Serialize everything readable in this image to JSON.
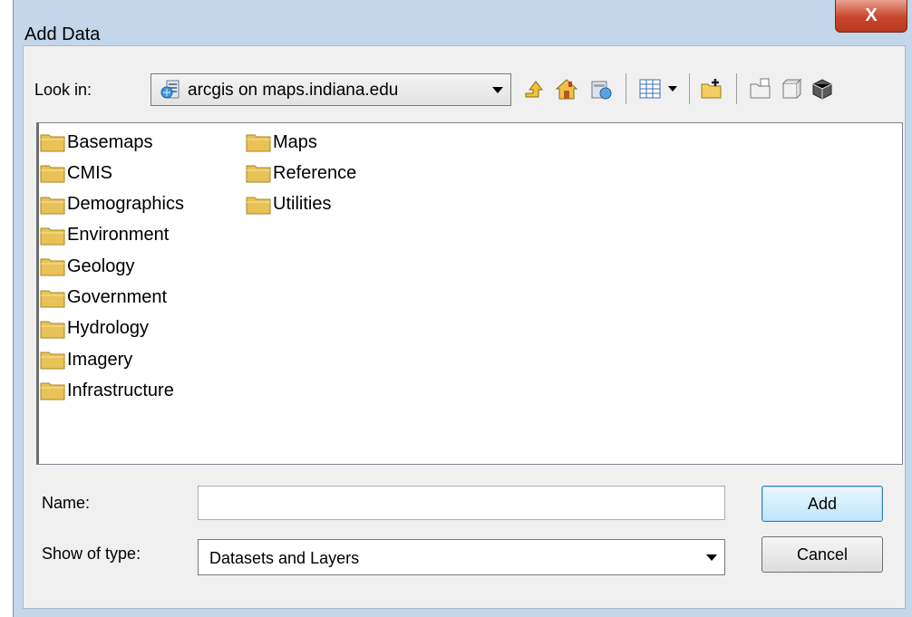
{
  "window": {
    "title": "Add Data",
    "close_glyph": "X"
  },
  "lookin": {
    "label": "Look in:",
    "value": "arcgis on maps.indiana.edu",
    "icon": "server-icon"
  },
  "toolbar": {
    "icons": [
      "up-one-level-icon",
      "home-icon",
      "connect-folder-icon",
      "view-list-icon",
      "view-dropdown-icon",
      "new-folder-icon",
      "new-file-geodatabase-icon",
      "new-shapefile-icon",
      "catalog-options-icon"
    ]
  },
  "folders": {
    "col1": [
      "Basemaps",
      "CMIS",
      "Demographics",
      "Environment",
      "Geology",
      "Government",
      "Hydrology",
      "Imagery",
      "Infrastructure"
    ],
    "col2": [
      "Maps",
      "Reference",
      "Utilities"
    ]
  },
  "name_field": {
    "label": "Name:",
    "value": ""
  },
  "type_field": {
    "label": "Show of type:",
    "value": "Datasets and Layers"
  },
  "buttons": {
    "add": "Add",
    "cancel": "Cancel"
  },
  "colors": {
    "folder": "#e8c257",
    "close_button": "#c8452c",
    "frame": "#c4d6ea"
  }
}
